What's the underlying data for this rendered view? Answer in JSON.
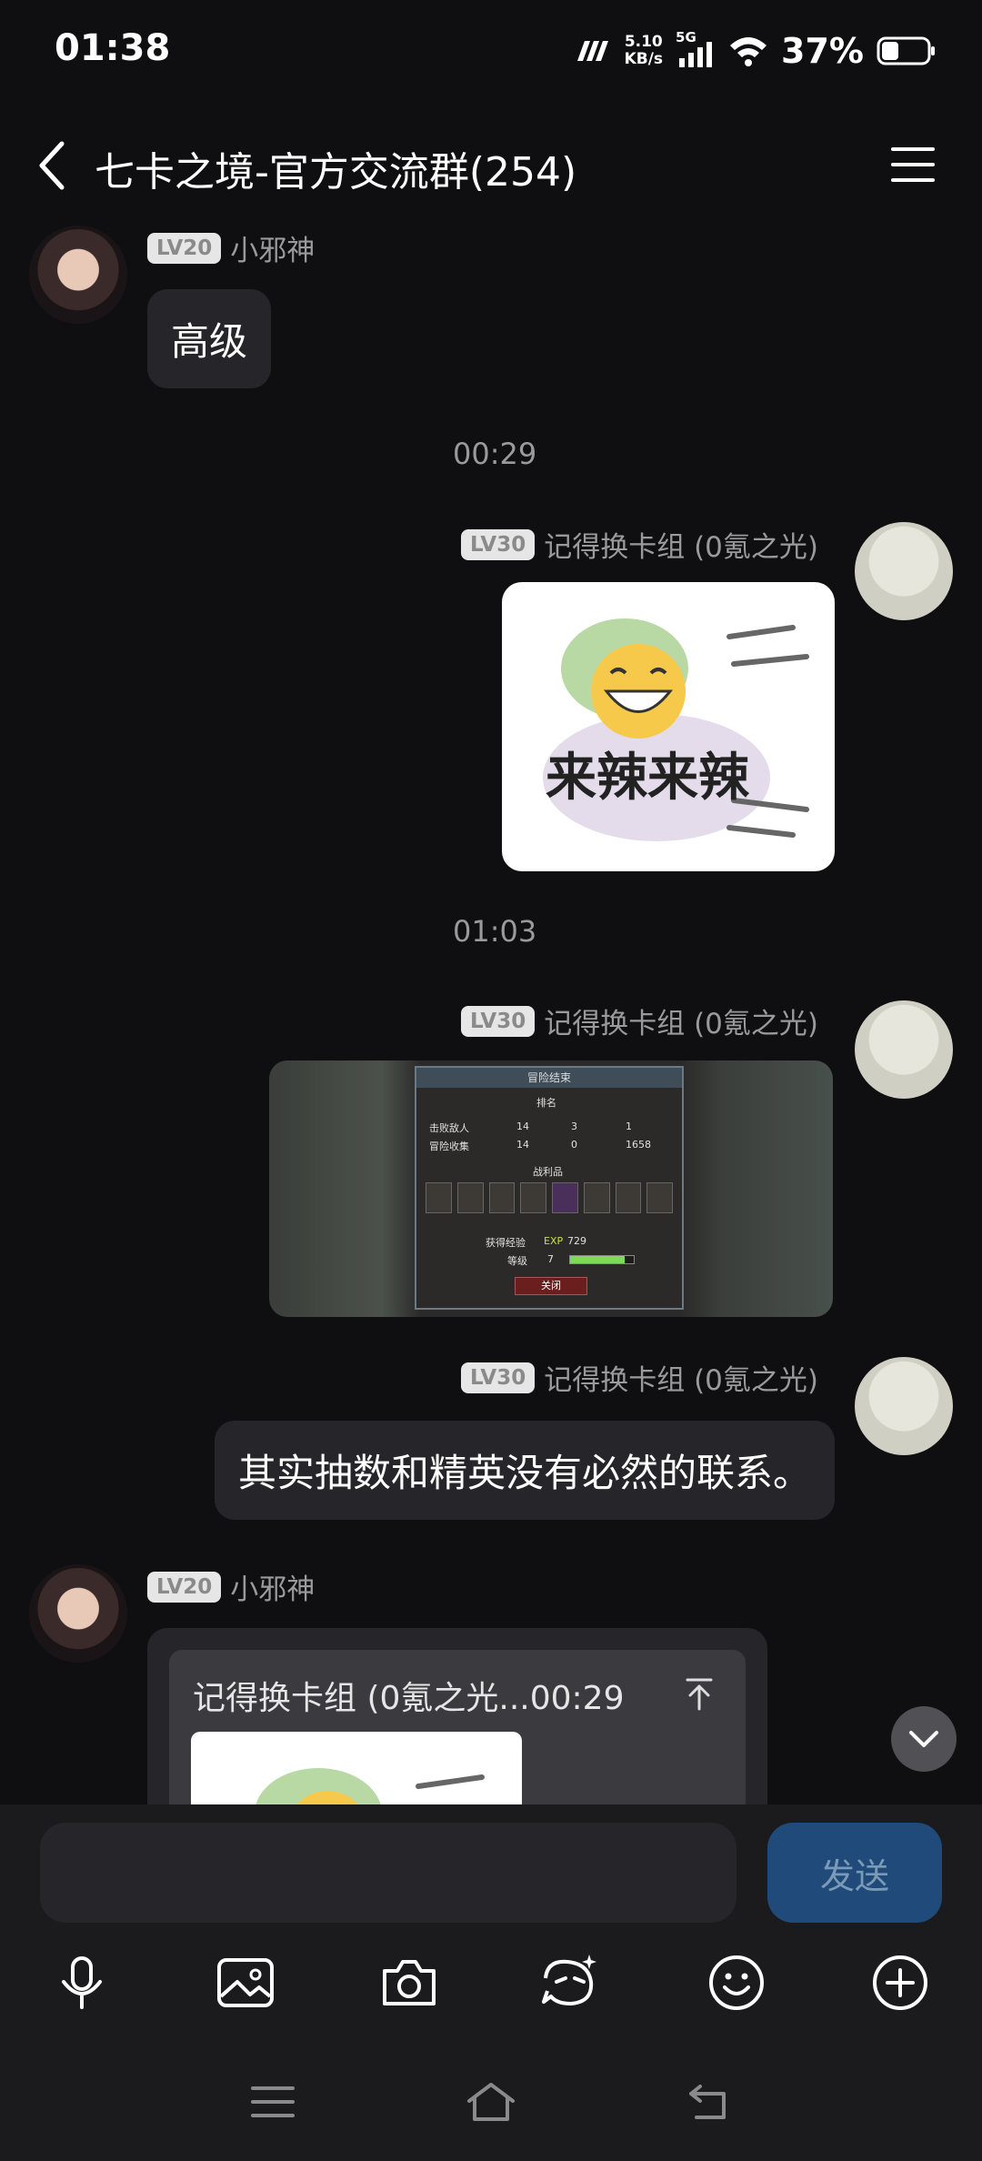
{
  "status_bar": {
    "time": "01:38",
    "net_speed_value": "5.10",
    "net_speed_unit": "KB/s",
    "network": "5G",
    "battery": "37%"
  },
  "header": {
    "title": "七卡之境-官方交流群(254)"
  },
  "messages": [
    {
      "type": "text",
      "side": "left",
      "level": "LV20",
      "sender": "小邪神",
      "text": "高级"
    },
    {
      "type": "timestamp",
      "text": "00:29"
    },
    {
      "type": "sticker",
      "side": "right",
      "level": "LV30",
      "sender": "记得换卡组 (0氪之光)",
      "sticker_text": "来辣来辣"
    },
    {
      "type": "timestamp",
      "text": "01:03"
    },
    {
      "type": "image",
      "side": "right",
      "level": "LV30",
      "sender": "记得换卡组 (0氪之光)",
      "game": {
        "title": "冒险结束",
        "rank_label": "排名",
        "defeated_label": "击败敌人",
        "collect_label": "冒险收集",
        "values": [
          "14",
          "3",
          "1",
          "14",
          "0",
          "1658"
        ],
        "loot_label": "战利品",
        "exp_label": "获得经验",
        "exp_tag": "EXP",
        "exp_value": "729",
        "level_label": "等级",
        "level_value": "7",
        "level_progress": 0.85,
        "close_label": "关闭"
      }
    },
    {
      "type": "text",
      "side": "right",
      "level": "LV30",
      "sender": "记得换卡组 (0氪之光)",
      "text": "其实抽数和精英没有必然的联系。"
    },
    {
      "type": "reply",
      "side": "left",
      "level": "LV20",
      "sender": "小邪神",
      "quote_header": "记得换卡组 (0氪之光...00:29"
    }
  ],
  "input": {
    "placeholder": "",
    "send_label": "发送"
  },
  "toolbar_icons": [
    "microphone-icon",
    "image-icon",
    "camera-icon",
    "super-emoji-icon",
    "emoji-icon",
    "plus-icon"
  ],
  "colors": {
    "background": "#0f0f11",
    "bubble": "#26262a",
    "send_button": "#1f4a7a"
  }
}
